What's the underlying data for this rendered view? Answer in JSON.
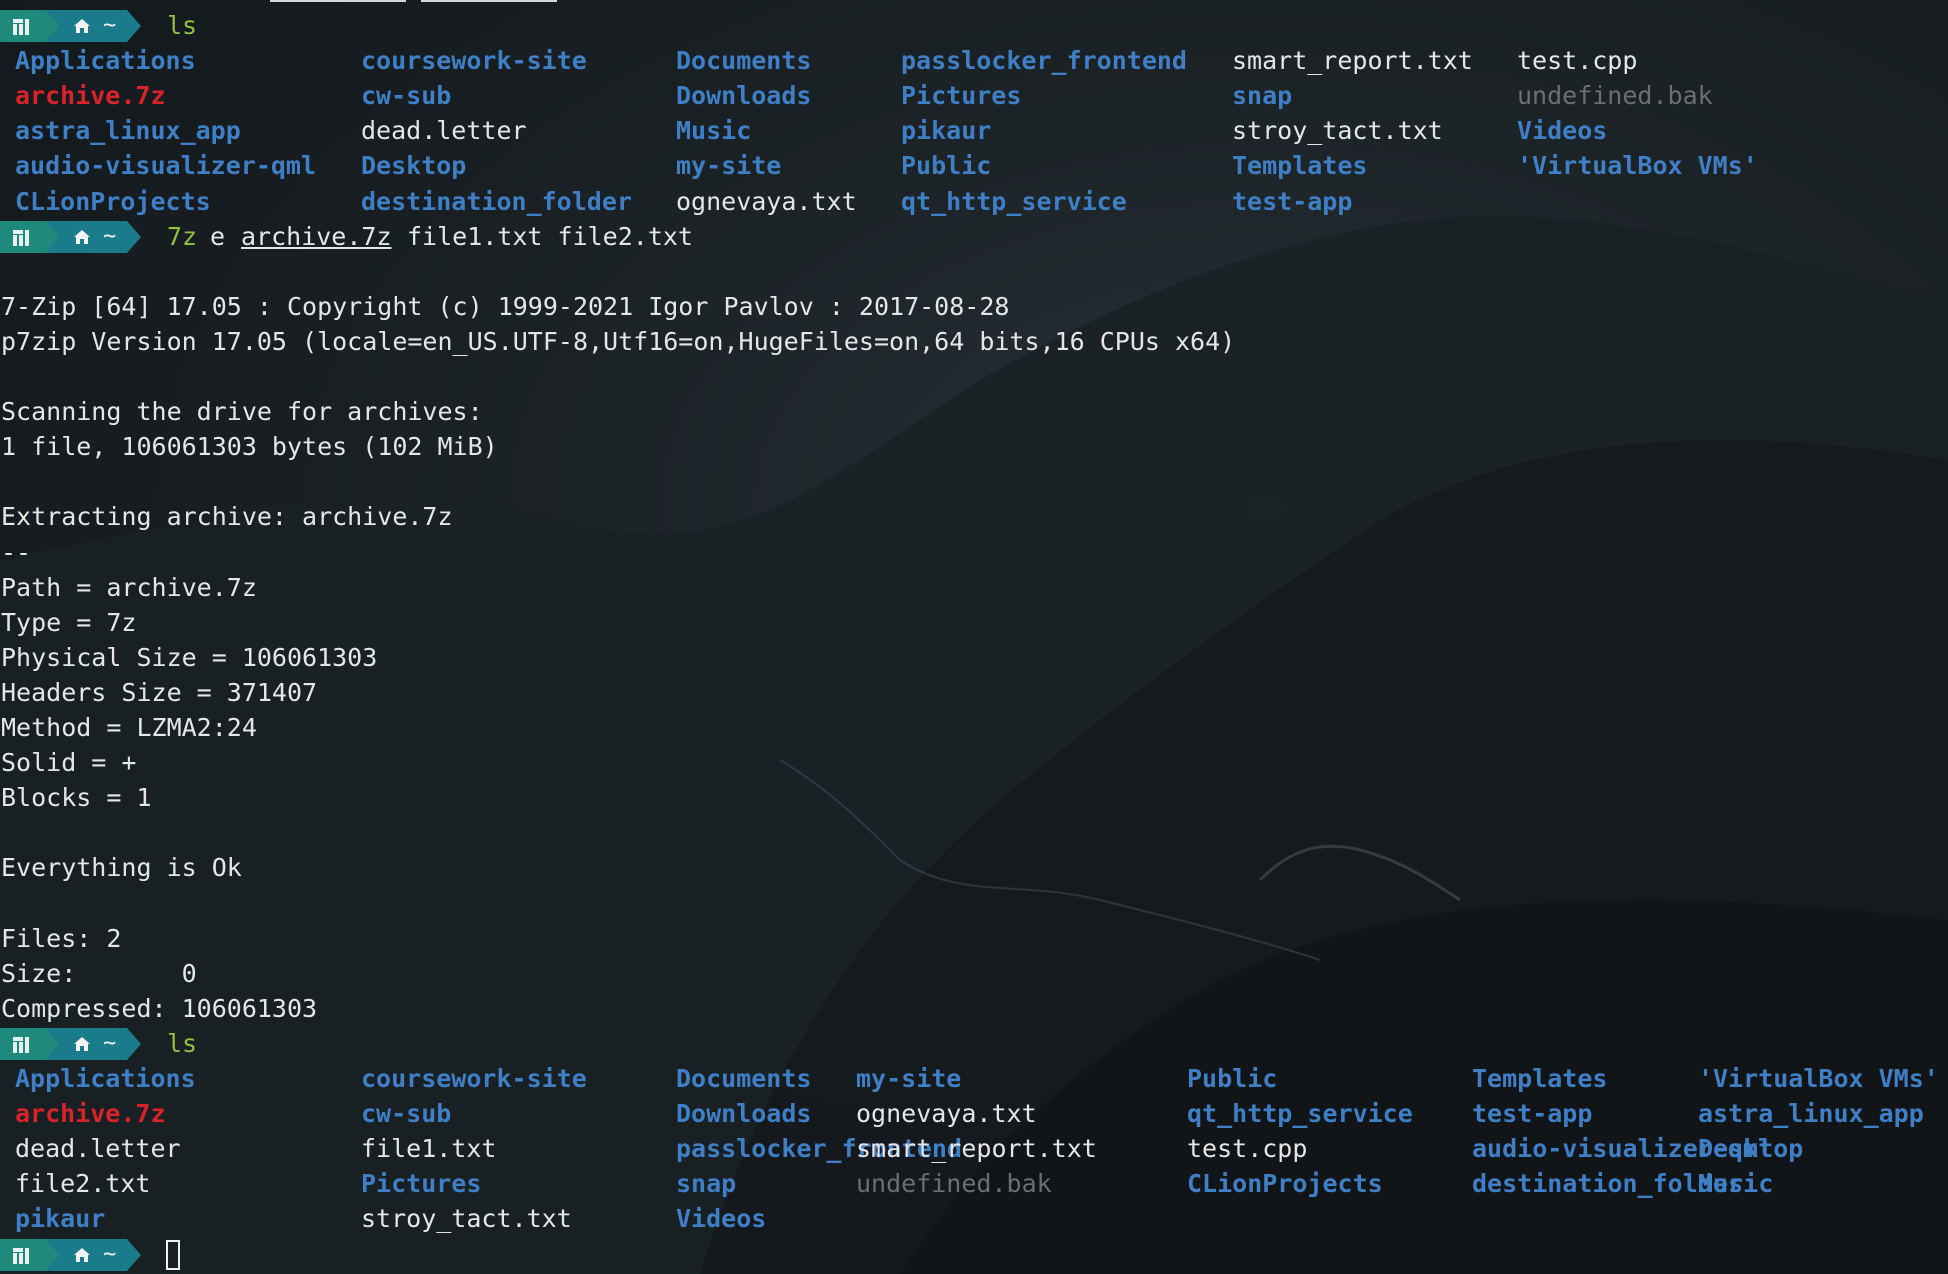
{
  "terminal": {
    "prompt_tilde": "~",
    "ls1": {
      "command": "ls",
      "entries": [
        {
          "text": "Applications",
          "type": "dir"
        },
        {
          "text": "coursework-site",
          "type": "dir"
        },
        {
          "text": "Documents",
          "type": "dir"
        },
        {
          "text": "passlocker_frontend",
          "type": "dir"
        },
        {
          "text": "smart_report.txt",
          "type": "file"
        },
        {
          "text": "test.cpp",
          "type": "file"
        },
        {
          "text": "archive.7z",
          "type": "archive"
        },
        {
          "text": "cw-sub",
          "type": "dir"
        },
        {
          "text": "Downloads",
          "type": "dir"
        },
        {
          "text": "Pictures",
          "type": "dir"
        },
        {
          "text": "snap",
          "type": "dir"
        },
        {
          "text": "undefined.bak",
          "type": "bak"
        },
        {
          "text": "astra_linux_app",
          "type": "dir"
        },
        {
          "text": "dead.letter",
          "type": "file"
        },
        {
          "text": "Music",
          "type": "dir"
        },
        {
          "text": "pikaur",
          "type": "dir"
        },
        {
          "text": "stroy_tact.txt",
          "type": "file"
        },
        {
          "text": "Videos",
          "type": "dir"
        },
        {
          "text": "audio-visualizer-qml",
          "type": "dir"
        },
        {
          "text": "Desktop",
          "type": "dir"
        },
        {
          "text": "my-site",
          "type": "dir"
        },
        {
          "text": "Public",
          "type": "dir"
        },
        {
          "text": "Templates",
          "type": "dir"
        },
        {
          "text": "'VirtualBox VMs'",
          "type": "dir"
        },
        {
          "text": "CLionProjects",
          "type": "dir"
        },
        {
          "text": "destination_folder",
          "type": "dir"
        },
        {
          "text": "ognevaya.txt",
          "type": "file"
        },
        {
          "text": "qt_http_service",
          "type": "dir"
        },
        {
          "text": "test-app",
          "type": "dir"
        }
      ]
    },
    "cmd2": {
      "program": "7z",
      "args_before": "e",
      "archive_arg": "archive.7z",
      "args_after": "file1.txt file2.txt"
    },
    "output": [
      "",
      "7-Zip [64] 17.05 : Copyright (c) 1999-2021 Igor Pavlov : 2017-08-28",
      "p7zip Version 17.05 (locale=en_US.UTF-8,Utf16=on,HugeFiles=on,64 bits,16 CPUs x64)",
      "",
      "Scanning the drive for archives:",
      "1 file, 106061303 bytes (102 MiB)",
      "",
      "Extracting archive: archive.7z",
      "--",
      "Path = archive.7z",
      "Type = 7z",
      "Physical Size = 106061303",
      "Headers Size = 371407",
      "Method = LZMA2:24",
      "Solid = +",
      "Blocks = 1",
      "",
      "Everything is Ok",
      "",
      "Files: 2",
      "Size:       0",
      "Compressed: 106061303"
    ],
    "ls2": {
      "command": "ls",
      "entries": [
        {
          "text": "Applications",
          "type": "dir"
        },
        {
          "text": "coursework-site",
          "type": "dir"
        },
        {
          "text": "Documents",
          "type": "dir"
        },
        {
          "text": "my-site",
          "type": "dir"
        },
        {
          "text": "Public",
          "type": "dir"
        },
        {
          "text": "Templates",
          "type": "dir"
        },
        {
          "text": "'VirtualBox VMs'",
          "type": "dir"
        },
        {
          "text": "archive.7z",
          "type": "archive"
        },
        {
          "text": "cw-sub",
          "type": "dir"
        },
        {
          "text": "Downloads",
          "type": "dir"
        },
        {
          "text": "ognevaya.txt",
          "type": "file"
        },
        {
          "text": "qt_http_service",
          "type": "dir"
        },
        {
          "text": "test-app",
          "type": "dir"
        },
        {
          "text": "astra_linux_app",
          "type": "dir"
        },
        {
          "text": "dead.letter",
          "type": "file"
        },
        {
          "text": "file1.txt",
          "type": "file"
        },
        {
          "text": "passlocker_frontend",
          "type": "dir"
        },
        {
          "text": "smart_report.txt",
          "type": "file"
        },
        {
          "text": "test.cpp",
          "type": "file"
        },
        {
          "text": "audio-visualizer-qml",
          "type": "dir"
        },
        {
          "text": "Desktop",
          "type": "dir"
        },
        {
          "text": "file2.txt",
          "type": "file"
        },
        {
          "text": "Pictures",
          "type": "dir"
        },
        {
          "text": "snap",
          "type": "dir"
        },
        {
          "text": "undefined.bak",
          "type": "bak"
        },
        {
          "text": "CLionProjects",
          "type": "dir"
        },
        {
          "text": "destination_folder",
          "type": "dir"
        },
        {
          "text": "Music",
          "type": "dir"
        },
        {
          "text": "pikaur",
          "type": "dir"
        },
        {
          "text": "stroy_tact.txt",
          "type": "file"
        },
        {
          "text": "Videos",
          "type": "dir"
        }
      ]
    }
  },
  "colors": {
    "dir": "#3f7fc6",
    "archive": "#d8232a",
    "file": "#e6e6e6",
    "bak": "#6b6f72",
    "command": "#8fc33e",
    "prompt_segment_1": "#1f8a7c",
    "prompt_segment_2": "#1a7b8a"
  },
  "icons": {
    "prompt_logo": "manjaro-logo-icon",
    "prompt_home": "home-icon",
    "cursor": "block-cursor"
  }
}
